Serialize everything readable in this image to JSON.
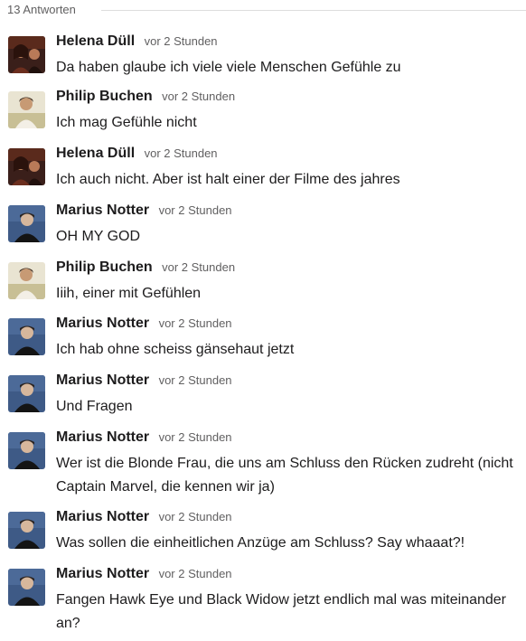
{
  "thread": {
    "reply_count_label": "13 Antworten"
  },
  "messages": [
    {
      "author": "Helena Düll",
      "time": "vor 2 Stunden",
      "text": "Da haben glaube ich viele viele Menschen Gefühle zu"
    },
    {
      "author": "Philip Buchen",
      "time": "vor 2 Stunden",
      "text": "Ich mag Gefühle nicht"
    },
    {
      "author": "Helena Düll",
      "time": "vor 2 Stunden",
      "text": "Ich auch nicht. Aber ist halt einer der Filme des jahres"
    },
    {
      "author": "Marius Notter",
      "time": "vor 2 Stunden",
      "text": "OH MY GOD"
    },
    {
      "author": "Philip Buchen",
      "time": "vor 2 Stunden",
      "text": "Iiih, einer mit Gefühlen"
    },
    {
      "author": "Marius Notter",
      "time": "vor 2 Stunden",
      "text": "Ich hab ohne scheiss gänsehaut jetzt"
    },
    {
      "author": "Marius Notter",
      "time": "vor 2 Stunden",
      "text": "Und Fragen"
    },
    {
      "author": "Marius Notter",
      "time": "vor 2 Stunden",
      "text": "Wer ist die Blonde Frau, die uns am Schluss den Rücken zudreht (nicht Captain Marvel, die kennen wir ja)"
    },
    {
      "author": "Marius Notter",
      "time": "vor 2 Stunden",
      "text": "Was sollen die einheitlichen Anzüge am Schluss? Say whaaat?!"
    },
    {
      "author": "Marius Notter",
      "time": "vor 2 Stunden",
      "text": "Fangen Hawk Eye und Black Widow jetzt endlich mal was miteinander an?"
    }
  ]
}
